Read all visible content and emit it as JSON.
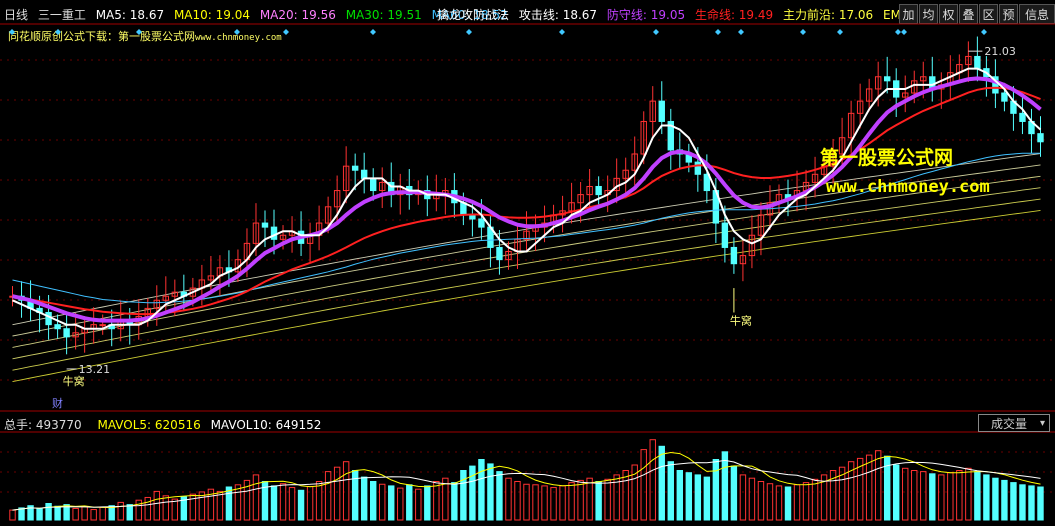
{
  "toolbar": {
    "stock_name": "日线",
    "ticker": "三一重工",
    "ma5": "MA5: 18.67",
    "ma10": "MA10: 19.04",
    "ma20": "MA20: 19.56",
    "ma30": "MA30: 19.51",
    "ma60": "MA60: 18.52",
    "indicator_name": "擒龙攻防战法",
    "attack": "攻击线: 18.67",
    "defense": "防守线: 19.05",
    "life": "生命线: 19.49",
    "main": "主力前沿: 17.06",
    "ema": "EMA",
    "buttons": [
      "加",
      "均",
      "权",
      "叠",
      "区",
      "预"
    ],
    "info_button": "信息"
  },
  "promo_text": "同花顺原创公式下载：第一股票公式网",
  "promo_url": "www.chnmoney.com",
  "watermark_cn": "第一股票公式网",
  "watermark_url": "www.chnmoney.com",
  "annotations": {
    "high_label": "21.03",
    "low_label": "13.21",
    "niuchao1": "牛窝",
    "niuchao2": "牛窝",
    "cai": "财"
  },
  "volume_panel": {
    "total": "总手: 493770",
    "mavol5": "MAVOL5: 620516",
    "mavol10": "MAVOL10: 649152",
    "select_label": "成交量"
  },
  "colors": {
    "up": "#ff3232",
    "down": "#54ffff",
    "ma5": "#ffffff",
    "ma10": "#ffff00",
    "ma20": "#ff80ff",
    "ma30": "#00e000",
    "ma60": "#40c0ff",
    "attack": "#ffffff",
    "defense": "#c040ff",
    "life": "#ff2020",
    "main": "#ffff40"
  },
  "chart_data": {
    "type": "candlestick",
    "price_range": [
      12.2,
      21.6
    ],
    "high": 21.03,
    "low": 13.21,
    "closes": [
      15.0,
      14.9,
      14.7,
      14.6,
      14.3,
      14.2,
      14.0,
      14.1,
      14.2,
      14.3,
      14.3,
      14.2,
      14.4,
      14.3,
      14.5,
      14.7,
      14.9,
      15.0,
      15.1,
      15.0,
      15.2,
      15.4,
      15.5,
      15.7,
      15.6,
      15.9,
      16.3,
      16.8,
      16.7,
      16.4,
      16.5,
      16.6,
      16.3,
      16.5,
      16.8,
      17.2,
      17.6,
      18.2,
      18.1,
      17.9,
      17.6,
      17.8,
      17.5,
      17.7,
      17.5,
      17.6,
      17.4,
      17.5,
      17.6,
      17.3,
      17.0,
      16.9,
      16.7,
      16.2,
      15.9,
      16.1,
      16.4,
      16.6,
      16.7,
      16.8,
      17.0,
      17.1,
      17.3,
      17.5,
      17.7,
      17.5,
      17.6,
      17.9,
      18.1,
      18.5,
      19.3,
      19.8,
      19.3,
      18.6,
      18.5,
      18.3,
      18.0,
      17.6,
      16.8,
      16.2,
      15.8,
      16.0,
      16.5,
      17.0,
      17.3,
      17.5,
      17.4,
      17.6,
      17.8,
      18.0,
      18.2,
      18.5,
      18.9,
      19.5,
      19.8,
      20.1,
      20.4,
      20.3,
      19.9,
      20.0,
      20.3,
      20.4,
      20.1,
      20.2,
      20.5,
      20.7,
      20.9,
      20.6,
      20.4,
      20.0,
      19.8,
      19.5,
      19.3,
      19.0,
      18.8
    ],
    "volume_range": [
      0,
      1600000
    ],
    "volumes": [
      180000,
      220000,
      260000,
      200000,
      300000,
      250000,
      280000,
      210000,
      240000,
      190000,
      230000,
      260000,
      320000,
      280000,
      360000,
      410000,
      520000,
      440000,
      380000,
      420000,
      470000,
      510000,
      560000,
      520000,
      600000,
      640000,
      720000,
      820000,
      700000,
      620000,
      660000,
      590000,
      540000,
      610000,
      700000,
      880000,
      960000,
      1060000,
      900000,
      780000,
      700000,
      650000,
      620000,
      580000,
      640000,
      560000,
      620000,
      700000,
      760000,
      680000,
      900000,
      980000,
      1100000,
      1020000,
      880000,
      760000,
      700000,
      650000,
      640000,
      620000,
      590000,
      620000,
      680000,
      720000,
      760000,
      700000,
      740000,
      820000,
      900000,
      1000000,
      1280000,
      1460000,
      1340000,
      1060000,
      900000,
      860000,
      820000,
      780000,
      1100000,
      1240000,
      980000,
      820000,
      760000,
      700000,
      660000,
      620000,
      600000,
      640000,
      680000,
      740000,
      820000,
      900000,
      960000,
      1060000,
      1120000,
      1180000,
      1260000,
      1160000,
      1000000,
      940000,
      900000,
      880000,
      840000,
      820000,
      860000,
      900000,
      940000,
      880000,
      820000,
      760000,
      720000,
      680000,
      640000,
      620000,
      600000
    ],
    "ma5": [
      14.9,
      14.8,
      14.7,
      14.6,
      14.5,
      14.4,
      14.3,
      14.3,
      14.2,
      14.2,
      14.2,
      14.3,
      14.3,
      14.3,
      14.3,
      14.4,
      14.6,
      14.8,
      14.9,
      15.0,
      15.1,
      15.2,
      15.3,
      15.5,
      15.6,
      15.7,
      15.9,
      16.2,
      16.4,
      16.5,
      16.6,
      16.6,
      16.5,
      16.5,
      16.5,
      16.7,
      17.0,
      17.4,
      17.7,
      17.9,
      17.9,
      17.9,
      17.7,
      17.7,
      17.6,
      17.6,
      17.5,
      17.5,
      17.5,
      17.4,
      17.3,
      17.2,
      17.0,
      16.7,
      16.4,
      16.2,
      16.1,
      16.1,
      16.3,
      16.5,
      16.7,
      16.8,
      17.0,
      17.1,
      17.3,
      17.4,
      17.5,
      17.7,
      17.8,
      18.0,
      18.4,
      18.9,
      19.2,
      19.2,
      19.1,
      18.9,
      18.5,
      18.1,
      17.6,
      17.0,
      16.6,
      16.4,
      16.3,
      16.4,
      16.7,
      17.0,
      17.2,
      17.4,
      17.5,
      17.7,
      17.9,
      18.1,
      18.4,
      18.8,
      19.2,
      19.6,
      19.9,
      20.1,
      20.1,
      20.1,
      20.2,
      20.2,
      20.2,
      20.3,
      20.4,
      20.5,
      20.6,
      20.6,
      20.5,
      20.3,
      20.1,
      19.8,
      19.6,
      19.3,
      19.1
    ],
    "defense": [
      15.0,
      14.95,
      14.9,
      14.82,
      14.74,
      14.66,
      14.58,
      14.52,
      14.46,
      14.42,
      14.4,
      14.4,
      14.4,
      14.4,
      14.42,
      14.46,
      14.52,
      14.6,
      14.68,
      14.76,
      14.86,
      14.98,
      15.1,
      15.24,
      15.36,
      15.5,
      15.68,
      15.88,
      16.06,
      16.18,
      16.3,
      16.4,
      16.46,
      16.5,
      16.56,
      16.66,
      16.8,
      17.0,
      17.18,
      17.32,
      17.42,
      17.5,
      17.54,
      17.56,
      17.56,
      17.56,
      17.54,
      17.52,
      17.5,
      17.46,
      17.4,
      17.32,
      17.22,
      17.08,
      16.94,
      16.84,
      16.76,
      16.72,
      16.72,
      16.74,
      16.8,
      16.86,
      16.94,
      17.02,
      17.12,
      17.2,
      17.28,
      17.38,
      17.5,
      17.66,
      17.9,
      18.18,
      18.4,
      18.52,
      18.56,
      18.52,
      18.42,
      18.26,
      18.02,
      17.74,
      17.48,
      17.3,
      17.2,
      17.18,
      17.22,
      17.3,
      17.38,
      17.46,
      17.56,
      17.68,
      17.82,
      17.98,
      18.18,
      18.42,
      18.7,
      19.0,
      19.28,
      19.52,
      19.68,
      19.8,
      19.92,
      20.02,
      20.1,
      20.16,
      20.22,
      20.28,
      20.34,
      20.36,
      20.34,
      20.28,
      20.2,
      20.08,
      19.94,
      19.78,
      19.6
    ],
    "life": [
      15.0,
      14.96,
      14.92,
      14.88,
      14.84,
      14.8,
      14.76,
      14.72,
      14.68,
      14.65,
      14.62,
      14.6,
      14.58,
      14.57,
      14.56,
      14.56,
      14.57,
      14.59,
      14.62,
      14.65,
      14.69,
      14.74,
      14.8,
      14.87,
      14.94,
      15.02,
      15.12,
      15.24,
      15.36,
      15.46,
      15.56,
      15.66,
      15.74,
      15.82,
      15.9,
      15.99,
      16.09,
      16.2,
      16.32,
      16.43,
      16.52,
      16.6,
      16.67,
      16.73,
      16.78,
      16.83,
      16.87,
      16.91,
      16.95,
      16.98,
      17.0,
      17.01,
      17.01,
      16.99,
      16.96,
      16.94,
      16.93,
      16.93,
      16.94,
      16.96,
      16.99,
      17.03,
      17.08,
      17.13,
      17.19,
      17.24,
      17.3,
      17.37,
      17.44,
      17.53,
      17.66,
      17.82,
      17.96,
      18.06,
      18.14,
      18.19,
      18.22,
      18.22,
      18.18,
      18.11,
      18.03,
      17.97,
      17.93,
      17.91,
      17.91,
      17.93,
      17.96,
      18.0,
      18.05,
      18.11,
      18.18,
      18.26,
      18.36,
      18.48,
      18.61,
      18.76,
      18.92,
      19.08,
      19.21,
      19.33,
      19.45,
      19.56,
      19.65,
      19.74,
      19.83,
      19.92,
      20.01,
      20.08,
      20.12,
      20.13,
      20.12,
      20.08,
      20.02,
      19.94,
      19.85
    ],
    "ma60": [
      15.4,
      15.35,
      15.3,
      15.25,
      15.2,
      15.15,
      15.1,
      15.05,
      15.0,
      14.96,
      14.92,
      14.9,
      14.88,
      14.86,
      14.85,
      14.84,
      14.84,
      14.85,
      14.86,
      14.88,
      14.9,
      14.93,
      14.96,
      15.0,
      15.04,
      15.08,
      15.13,
      15.19,
      15.25,
      15.3,
      15.35,
      15.4,
      15.45,
      15.5,
      15.55,
      15.6,
      15.66,
      15.72,
      15.79,
      15.85,
      15.91,
      15.96,
      16.01,
      16.06,
      16.1,
      16.14,
      16.18,
      16.22,
      16.26,
      16.29,
      16.32,
      16.35,
      16.37,
      16.38,
      16.39,
      16.4,
      16.41,
      16.42,
      16.43,
      16.45,
      16.47,
      16.49,
      16.52,
      16.55,
      16.58,
      16.61,
      16.64,
      16.67,
      16.71,
      16.75,
      16.8,
      16.86,
      16.92,
      16.97,
      17.01,
      17.05,
      17.08,
      17.1,
      17.12,
      17.13,
      17.13,
      17.13,
      17.13,
      17.14,
      17.15,
      17.17,
      17.19,
      17.21,
      17.24,
      17.27,
      17.31,
      17.35,
      17.4,
      17.46,
      17.52,
      17.59,
      17.66,
      17.73,
      17.8,
      17.87,
      17.94,
      18.01,
      18.07,
      18.13,
      18.19,
      18.25,
      18.31,
      18.36,
      18.41,
      18.45,
      18.48,
      18.5,
      18.52,
      18.52,
      18.52
    ]
  }
}
